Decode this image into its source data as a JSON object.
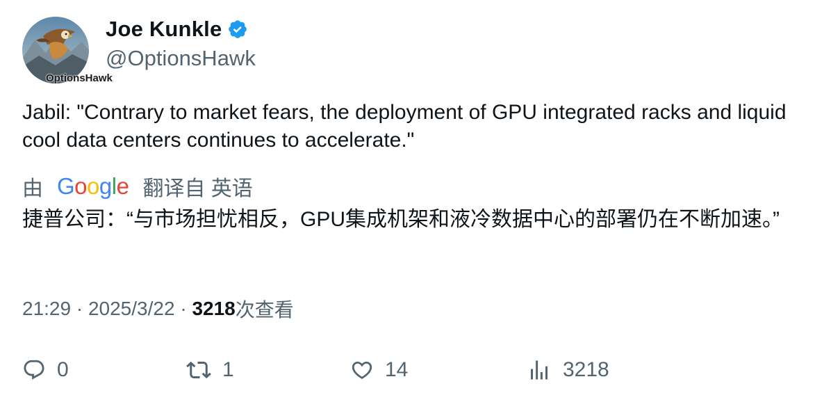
{
  "author": {
    "display_name": "Joe Kunkle",
    "handle": "@OptionsHawk",
    "verified": true,
    "avatar_text": "OptionsHawk"
  },
  "tweet": {
    "text": "Jabil: \"Contrary to market fears, the deployment of GPU integrated racks and liquid cool data centers continues to accelerate.\""
  },
  "translation": {
    "by": "由",
    "provider": "Google",
    "from": "翻译自 英语",
    "text": "捷普公司：“与市场担忧相反，GPU集成机架和液冷数据中心的部署仍在不断加速。”"
  },
  "meta": {
    "time": "21:29",
    "separator": " · ",
    "date": "2025/3/22",
    "views": "3218",
    "views_label": "次查看"
  },
  "actions": {
    "replies": "0",
    "retweets": "1",
    "likes": "14",
    "views": "3218"
  },
  "colors": {
    "verified": "#1d9bf0",
    "secondary_text": "#536471",
    "primary_text": "#0f1419",
    "google_blue": "#4285f4",
    "google_red": "#ea4335",
    "google_yellow": "#fbbc05",
    "google_green": "#34a853"
  },
  "icons": {
    "reply": "reply-icon",
    "retweet": "retweet-icon",
    "like": "heart-icon",
    "views": "views-icon",
    "verified": "verified-badge-icon"
  }
}
